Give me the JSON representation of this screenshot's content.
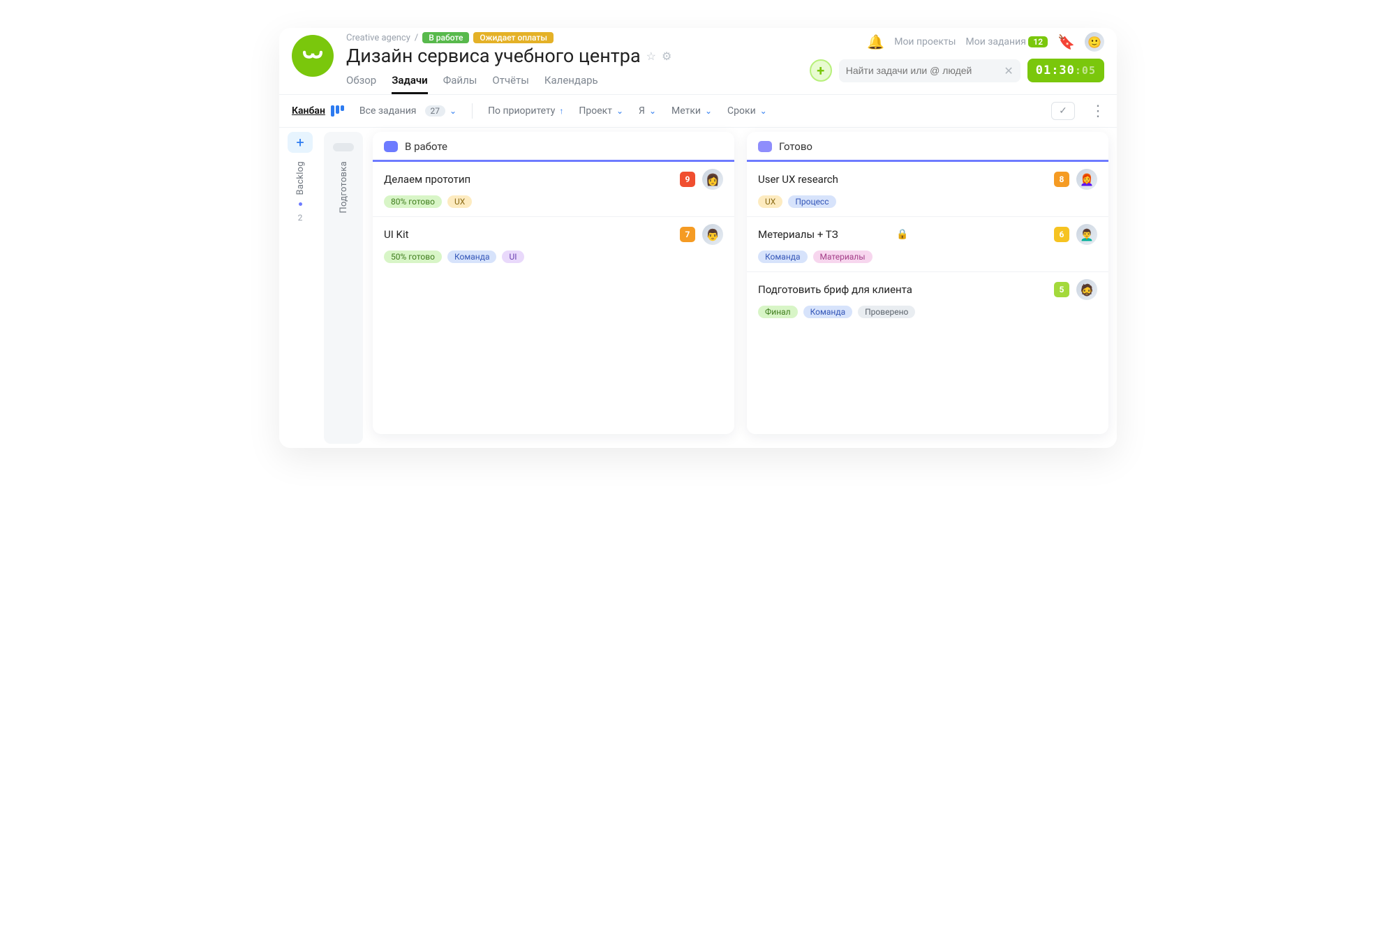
{
  "breadcrumb": {
    "parent": "Creative agency",
    "sep": "/"
  },
  "status_chips": {
    "working": "В работе",
    "awaiting": "Ожидает оплаты"
  },
  "title": "Дизайн сервиса учебного центра",
  "tabs": {
    "overview": "Обзор",
    "tasks": "Задачи",
    "files": "Файлы",
    "reports": "Отчёты",
    "calendar": "Календарь"
  },
  "header": {
    "projects": "Мои проекты",
    "my_tasks": "Мои задания",
    "my_tasks_count": "12",
    "search_placeholder": "Найти задачи или @ людей",
    "timer_main": "01:30",
    "timer_sec": ":05"
  },
  "filter": {
    "view": "Канбан",
    "all_tasks": "Все задания",
    "all_tasks_count": "27",
    "priority": "По приоритету",
    "project": "Проект",
    "me": "Я",
    "labels": "Метки",
    "due": "Сроки"
  },
  "rails": {
    "backlog": "Backlog",
    "backlog_count": "2",
    "prep": "Подготовка"
  },
  "columns": {
    "in_progress": {
      "title": "В работе",
      "tasks": [
        {
          "title": "Делаем прототип",
          "priority": "9",
          "tags": [
            {
              "text": "80% готово",
              "c": "green"
            },
            {
              "text": "UX",
              "c": "amberL"
            }
          ]
        },
        {
          "title": "UI Kit",
          "priority": "7",
          "tags": [
            {
              "text": "50% готово",
              "c": "green"
            },
            {
              "text": "Команда",
              "c": "blue"
            },
            {
              "text": "UI",
              "c": "violet"
            }
          ]
        }
      ]
    },
    "done": {
      "title": "Готово",
      "tasks": [
        {
          "title": "User UX research",
          "priority": "8",
          "tags": [
            {
              "text": "UX",
              "c": "amberL"
            },
            {
              "text": "Процесс",
              "c": "blue"
            }
          ]
        },
        {
          "title": "Метериалы + ТЗ",
          "priority": "6",
          "locked": true,
          "tags": [
            {
              "text": "Команда",
              "c": "blue"
            },
            {
              "text": "Материалы",
              "c": "pink"
            }
          ]
        },
        {
          "title": "Подготовить бриф для клиента",
          "priority": "5",
          "tags": [
            {
              "text": "Финал",
              "c": "green"
            },
            {
              "text": "Команда",
              "c": "blue"
            },
            {
              "text": "Проверено",
              "c": "grey"
            }
          ]
        }
      ]
    }
  }
}
